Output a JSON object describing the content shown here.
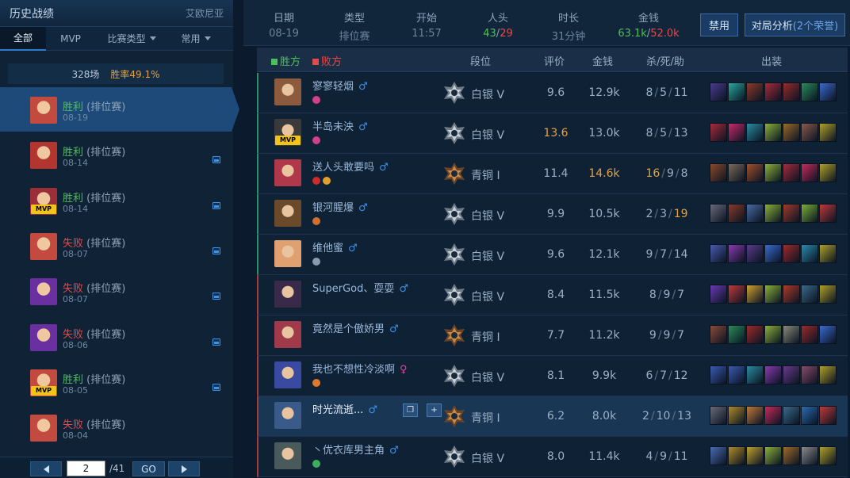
{
  "left": {
    "title": "历史战绩",
    "region": "艾欧尼亚",
    "tabs": [
      "全部",
      "MVP",
      "比赛类型",
      "常用"
    ],
    "summary": {
      "count": "328场",
      "winrate": "胜率49.1%"
    },
    "matches": [
      {
        "result": "胜利",
        "mode": "(排位赛)",
        "date": "08-19",
        "win": true,
        "mvp": false,
        "pic": false,
        "face": "#c24a3f"
      },
      {
        "result": "胜利",
        "mode": "(排位赛)",
        "date": "08-14",
        "win": true,
        "mvp": false,
        "pic": true,
        "face": "#b3352f"
      },
      {
        "result": "胜利",
        "mode": "(排位赛)",
        "date": "08-14",
        "win": true,
        "mvp": true,
        "pic": true,
        "face": "#9a2f3a"
      },
      {
        "result": "失败",
        "mode": "(排位赛)",
        "date": "08-07",
        "win": false,
        "mvp": false,
        "pic": true,
        "face": "#c24a3f"
      },
      {
        "result": "失败",
        "mode": "(排位赛)",
        "date": "08-07",
        "win": false,
        "mvp": false,
        "pic": true,
        "face": "#6a2fa0"
      },
      {
        "result": "失败",
        "mode": "(排位赛)",
        "date": "08-06",
        "win": false,
        "mvp": false,
        "pic": true,
        "face": "#6a2fa0"
      },
      {
        "result": "胜利",
        "mode": "(排位赛)",
        "date": "08-05",
        "win": true,
        "mvp": true,
        "pic": true,
        "face": "#c24a3f"
      },
      {
        "result": "失败",
        "mode": "(排位赛)",
        "date": "08-04",
        "win": false,
        "mvp": false,
        "pic": false,
        "face": "#c24a3f"
      }
    ],
    "pager": {
      "current": "2",
      "total": "/41",
      "go": "GO"
    }
  },
  "info": {
    "date_label": "日期",
    "date": "08-19",
    "type_label": "类型",
    "type": "排位赛",
    "start_label": "开始",
    "start": "11:57",
    "kills_label": "人头",
    "kills_win": "43",
    "kills_sep": "/",
    "kills_loss": "29",
    "dur_label": "时长",
    "duration": "31分钟",
    "gold_label": "金钱",
    "gold_win": "63.1k",
    "gold_sep": "/",
    "gold_loss": "52.0k",
    "ban_button": "禁用",
    "analysis_button": "对局分析",
    "analysis_count": "(2个荣誉)"
  },
  "table_header": {
    "win_team": "胜方",
    "lose_team": "败方",
    "rank": "段位",
    "score": "评价",
    "gold": "金钱",
    "kda": "杀/死/助",
    "items": "出装"
  },
  "players": [
    {
      "name": "寥寥轻烟",
      "gender": "m",
      "team": "win",
      "tier": "silver",
      "tier_name": "白银 V",
      "score": "9.6",
      "score_hi": false,
      "gold": "12.9k",
      "gold_hi": false,
      "k": "8",
      "d": "5",
      "a": "11",
      "hk": false,
      "ha": false,
      "face": "#8c5a3c",
      "mvp": false,
      "spells": [
        "#d23f8c"
      ],
      "items": [
        "#4b3a8c",
        "#2aa7a0",
        "#8c3a2a",
        "#a82a3a",
        "#9a2a2a",
        "#2a8c5a",
        "#3a6ad0"
      ]
    },
    {
      "name": "半岛未泱",
      "gender": "m",
      "team": "win",
      "tier": "silver",
      "tier_name": "白银 V",
      "score": "13.6",
      "score_hi": true,
      "gold": "13.0k",
      "gold_hi": false,
      "k": "8",
      "d": "5",
      "a": "13",
      "hk": false,
      "ha": false,
      "face": "#3a3a3a",
      "mvp": true,
      "spells": [
        "#d23f8c"
      ],
      "items": [
        "#a82a3a",
        "#c82a6a",
        "#2a8ca0",
        "#8cb03a",
        "#9a6a2a",
        "#8a5a4a",
        "#b0a02a"
      ]
    },
    {
      "name": "送人头敢要吗",
      "gender": "m",
      "team": "win",
      "tier": "bronze",
      "tier_name": "青铜 I",
      "score": "11.4",
      "score_hi": false,
      "gold": "14.6k",
      "gold_hi": true,
      "k": "16",
      "d": "9",
      "a": "8",
      "hk": true,
      "ha": false,
      "face": "#b0384a",
      "mvp": false,
      "spells": [
        "#d02a2a",
        "#e0a030"
      ],
      "items": [
        "#8c4a2a",
        "#7a6a5a",
        "#a0502a",
        "#8cb03a",
        "#a82a3a",
        "#c82a5a",
        "#b0a02a"
      ]
    },
    {
      "name": "银河腥爆",
      "gender": "m",
      "team": "win",
      "tier": "silver",
      "tier_name": "白银 V",
      "score": "9.9",
      "score_hi": false,
      "gold": "10.5k",
      "gold_hi": false,
      "k": "2",
      "d": "3",
      "a": "19",
      "hk": false,
      "ha": true,
      "face": "#6a4a2a",
      "mvp": false,
      "spells": [
        "#d07030"
      ],
      "items": [
        "#6a6a7a",
        "#8a3a2a",
        "#4a6aa0",
        "#8cb03a",
        "#a03a2a",
        "#7ab03a",
        "#c03a3a"
      ]
    },
    {
      "name": "维他蜜",
      "gender": "m",
      "team": "win",
      "tier": "silver",
      "tier_name": "白银 V",
      "score": "9.6",
      "score_hi": false,
      "gold": "12.1k",
      "gold_hi": false,
      "k": "9",
      "d": "7",
      "a": "14",
      "hk": false,
      "ha": false,
      "face": "#e0a070",
      "mvp": false,
      "spells": [
        "#8a9ab0"
      ],
      "items": [
        "#4a5ab0",
        "#8a3ab0",
        "#5a3a8a",
        "#3a6ad0",
        "#a02a2a",
        "#2a8cb0",
        "#b0a02a"
      ]
    },
    {
      "name": "SuperGod、耍耍",
      "gender": "m",
      "team": "loss",
      "tier": "silver",
      "tier_name": "白银 V",
      "score": "8.4",
      "score_hi": false,
      "gold": "11.5k",
      "gold_hi": false,
      "k": "8",
      "d": "9",
      "a": "7",
      "hk": false,
      "ha": false,
      "face": "#3a2a4a",
      "mvp": false,
      "spells": [],
      "items": [
        "#6a3ab0",
        "#c03a3a",
        "#d0a030",
        "#8cb03a",
        "#b03a2a",
        "#3a6a8a",
        "#b0a02a"
      ]
    },
    {
      "name": "竟然是个傲娇男",
      "gender": "m",
      "team": "loss",
      "tier": "bronze",
      "tier_name": "青铜 I",
      "score": "7.7",
      "score_hi": false,
      "gold": "11.2k",
      "gold_hi": false,
      "k": "9",
      "d": "9",
      "a": "7",
      "hk": false,
      "ha": false,
      "face": "#a03a4a",
      "mvp": false,
      "spells": [],
      "items": [
        "#8c4a3a",
        "#2a8c5a",
        "#a02a2a",
        "#8cb03a",
        "#8a8a7a",
        "#9a2a2a",
        "#3a6ad0"
      ]
    },
    {
      "name": "我也不想性冷淡啊",
      "gender": "f",
      "team": "loss",
      "tier": "silver",
      "tier_name": "白银 V",
      "score": "8.1",
      "score_hi": false,
      "gold": "9.9k",
      "gold_hi": false,
      "k": "6",
      "d": "7",
      "a": "12",
      "hk": false,
      "ha": false,
      "face": "#3a4aa0",
      "mvp": false,
      "spells": [
        "#e07a2a"
      ],
      "items": [
        "#3a5ab0",
        "#3a5ab0",
        "#2a8ca0",
        "#8a3ab0",
        "#6a3a8a",
        "#8a4a6a",
        "#b0a02a"
      ]
    },
    {
      "name": "时光流逝...",
      "gender": "m",
      "team": "loss",
      "tier": "bronze",
      "tier_name": "青铜 I",
      "score": "6.2",
      "score_hi": false,
      "gold": "8.0k",
      "gold_hi": false,
      "k": "2",
      "d": "10",
      "a": "13",
      "hk": false,
      "ha": false,
      "face": "#3a5a8a",
      "mvp": false,
      "hl": true,
      "spells": [],
      "items": [
        "#6a6a7a",
        "#b08a2a",
        "#c07a3a",
        "#c82a5a",
        "#3a6a8a",
        "#2a6ab0",
        "#c03a3a"
      ]
    },
    {
      "name": "丶优衣库男主角",
      "gender": "m",
      "team": "loss",
      "tier": "silver",
      "tier_name": "白银 V",
      "score": "8.0",
      "score_hi": false,
      "gold": "11.4k",
      "gold_hi": false,
      "k": "4",
      "d": "9",
      "a": "11",
      "hk": false,
      "ha": false,
      "face": "#4a5a5a",
      "mvp": false,
      "spells": [
        "#3ab05a"
      ],
      "items": [
        "#4a6ab0",
        "#b08a2a",
        "#c0a030",
        "#8cb03a",
        "#a06a2a",
        "#8a8a8a",
        "#b0a02a"
      ]
    }
  ],
  "colors": {
    "win": "#4dbf5a",
    "loss": "#e14b4b",
    "accent": "#e4a23f"
  }
}
